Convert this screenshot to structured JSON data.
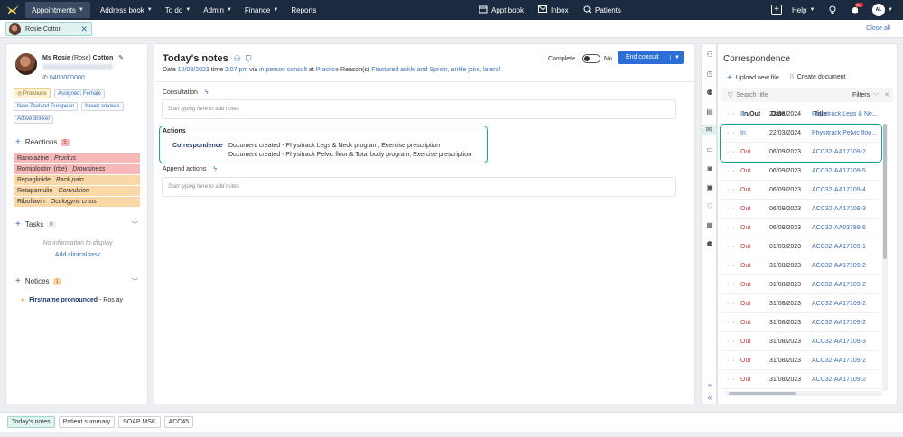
{
  "nav": {
    "items": [
      "Appointments",
      "Address book",
      "To do",
      "Admin",
      "Finance",
      "Reports"
    ],
    "center": [
      "Appt book",
      "Inbox",
      "Patients"
    ],
    "help": "Help",
    "notifications_count": "99+",
    "user_initials": "AL"
  },
  "patient_tab": {
    "name": "Rosie Cotton",
    "close_all": "Close all"
  },
  "patient": {
    "title": "Ms",
    "first": "Rosie",
    "preferred": "(Rose)",
    "last": "Cotton",
    "phone": "0400000000",
    "badges": [
      "Pronouns",
      "Assigned: Female",
      "New Zealand European",
      "Never smokes",
      "Active drinker"
    ],
    "reactions_label": "Reactions",
    "reactions_count": "5",
    "reactions": [
      {
        "drug": "Ranolazine",
        "effect": "Pruritus",
        "color": "#f6b8b8"
      },
      {
        "drug": "Romiplostim (rbe)",
        "effect": "Drowsiness",
        "color": "#f6b8b8"
      },
      {
        "drug": "Repaglinide",
        "effect": "Back pain",
        "color": "#fbd8a8"
      },
      {
        "drug": "Retapamulin",
        "effect": "Convulsion",
        "color": "#fbd8a8"
      },
      {
        "drug": "Riboflavin",
        "effect": "Oculogyric crisis",
        "color": "#fbd8a8"
      }
    ],
    "tasks_label": "Tasks",
    "tasks_count": "0",
    "tasks_empty": "No information to display",
    "add_task": "Add clinical task",
    "notices_label": "Notices",
    "notices_count": "1",
    "notice_bold": "Firstname pronounced",
    "notice_rest": "- Ros ay"
  },
  "notes": {
    "title": "Today's notes",
    "date_prefix": "Date",
    "date": "10/08/2023",
    "time_prefix": "time",
    "time": "2:07 pm",
    "via_prefix": "via",
    "via": "in person consult",
    "at_prefix": "at",
    "at": "Practice",
    "reasons_prefix": "Reason(s)",
    "reasons": "Fractured ankle and Sprain, ankle joint, lateral",
    "complete_label": "Complete",
    "toggle_value": "No",
    "end_consult": "End consult",
    "consultation_label": "Consultation",
    "placeholder": "Start typing here to add notes",
    "actions_label": "Actions",
    "correspondence_label": "Correspondence",
    "action_lines": [
      "Document created - Physitrack Legs & Neck program, Exercise prescription",
      "Document created - Physitrack Pelvic floor & Total body program, Exercise prescription"
    ],
    "append_label": "Append actions"
  },
  "correspondence": {
    "title": "Correspondence",
    "upload": "Upload new file",
    "create": "Create document",
    "search_placeholder": "Search title",
    "filters": "Filters",
    "columns": [
      "In/Out",
      "Date",
      "Title"
    ],
    "rows": [
      {
        "io": "In",
        "date": "22/03/2024",
        "title": "Physitrack Legs & Ne..."
      },
      {
        "io": "In",
        "date": "22/03/2024",
        "title": "Physitrack Pelvic floo..."
      },
      {
        "io": "Out",
        "date": "06/09/2023",
        "title": "ACC32-AA17109-2"
      },
      {
        "io": "Out",
        "date": "06/09/2023",
        "title": "ACC32-AA17109-5"
      },
      {
        "io": "Out",
        "date": "06/09/2023",
        "title": "ACC32-AA17109-4"
      },
      {
        "io": "Out",
        "date": "06/09/2023",
        "title": "ACC32-AA17109-3"
      },
      {
        "io": "Out",
        "date": "06/09/2023",
        "title": "ACC32-AA03789-6"
      },
      {
        "io": "Out",
        "date": "01/09/2023",
        "title": "ACC32-AA17109-1"
      },
      {
        "io": "Out",
        "date": "31/08/2023",
        "title": "ACC32-AA17109-2"
      },
      {
        "io": "Out",
        "date": "31/08/2023",
        "title": "ACC32-AA17109-2"
      },
      {
        "io": "Out",
        "date": "31/08/2023",
        "title": "ACC32-AA17109-2"
      },
      {
        "io": "Out",
        "date": "31/08/2023",
        "title": "ACC32-AA17109-2"
      },
      {
        "io": "Out",
        "date": "31/08/2023",
        "title": "ACC32-AA17109-3"
      },
      {
        "io": "Out",
        "date": "31/08/2023",
        "title": "ACC32-AA17109-2"
      },
      {
        "io": "Out",
        "date": "31/08/2023",
        "title": "ACC32-AA17109-2"
      }
    ]
  },
  "bottom_tabs": [
    "Today's notes",
    "Patient summary",
    "SOAP MSK",
    "ACC45"
  ],
  "colors": {
    "nav_bg": "#1b2a3e",
    "accent": "#3b6fb6",
    "primary_button": "#2b6fd6",
    "highlight": "#17a58f",
    "out": "#d23b3b"
  }
}
